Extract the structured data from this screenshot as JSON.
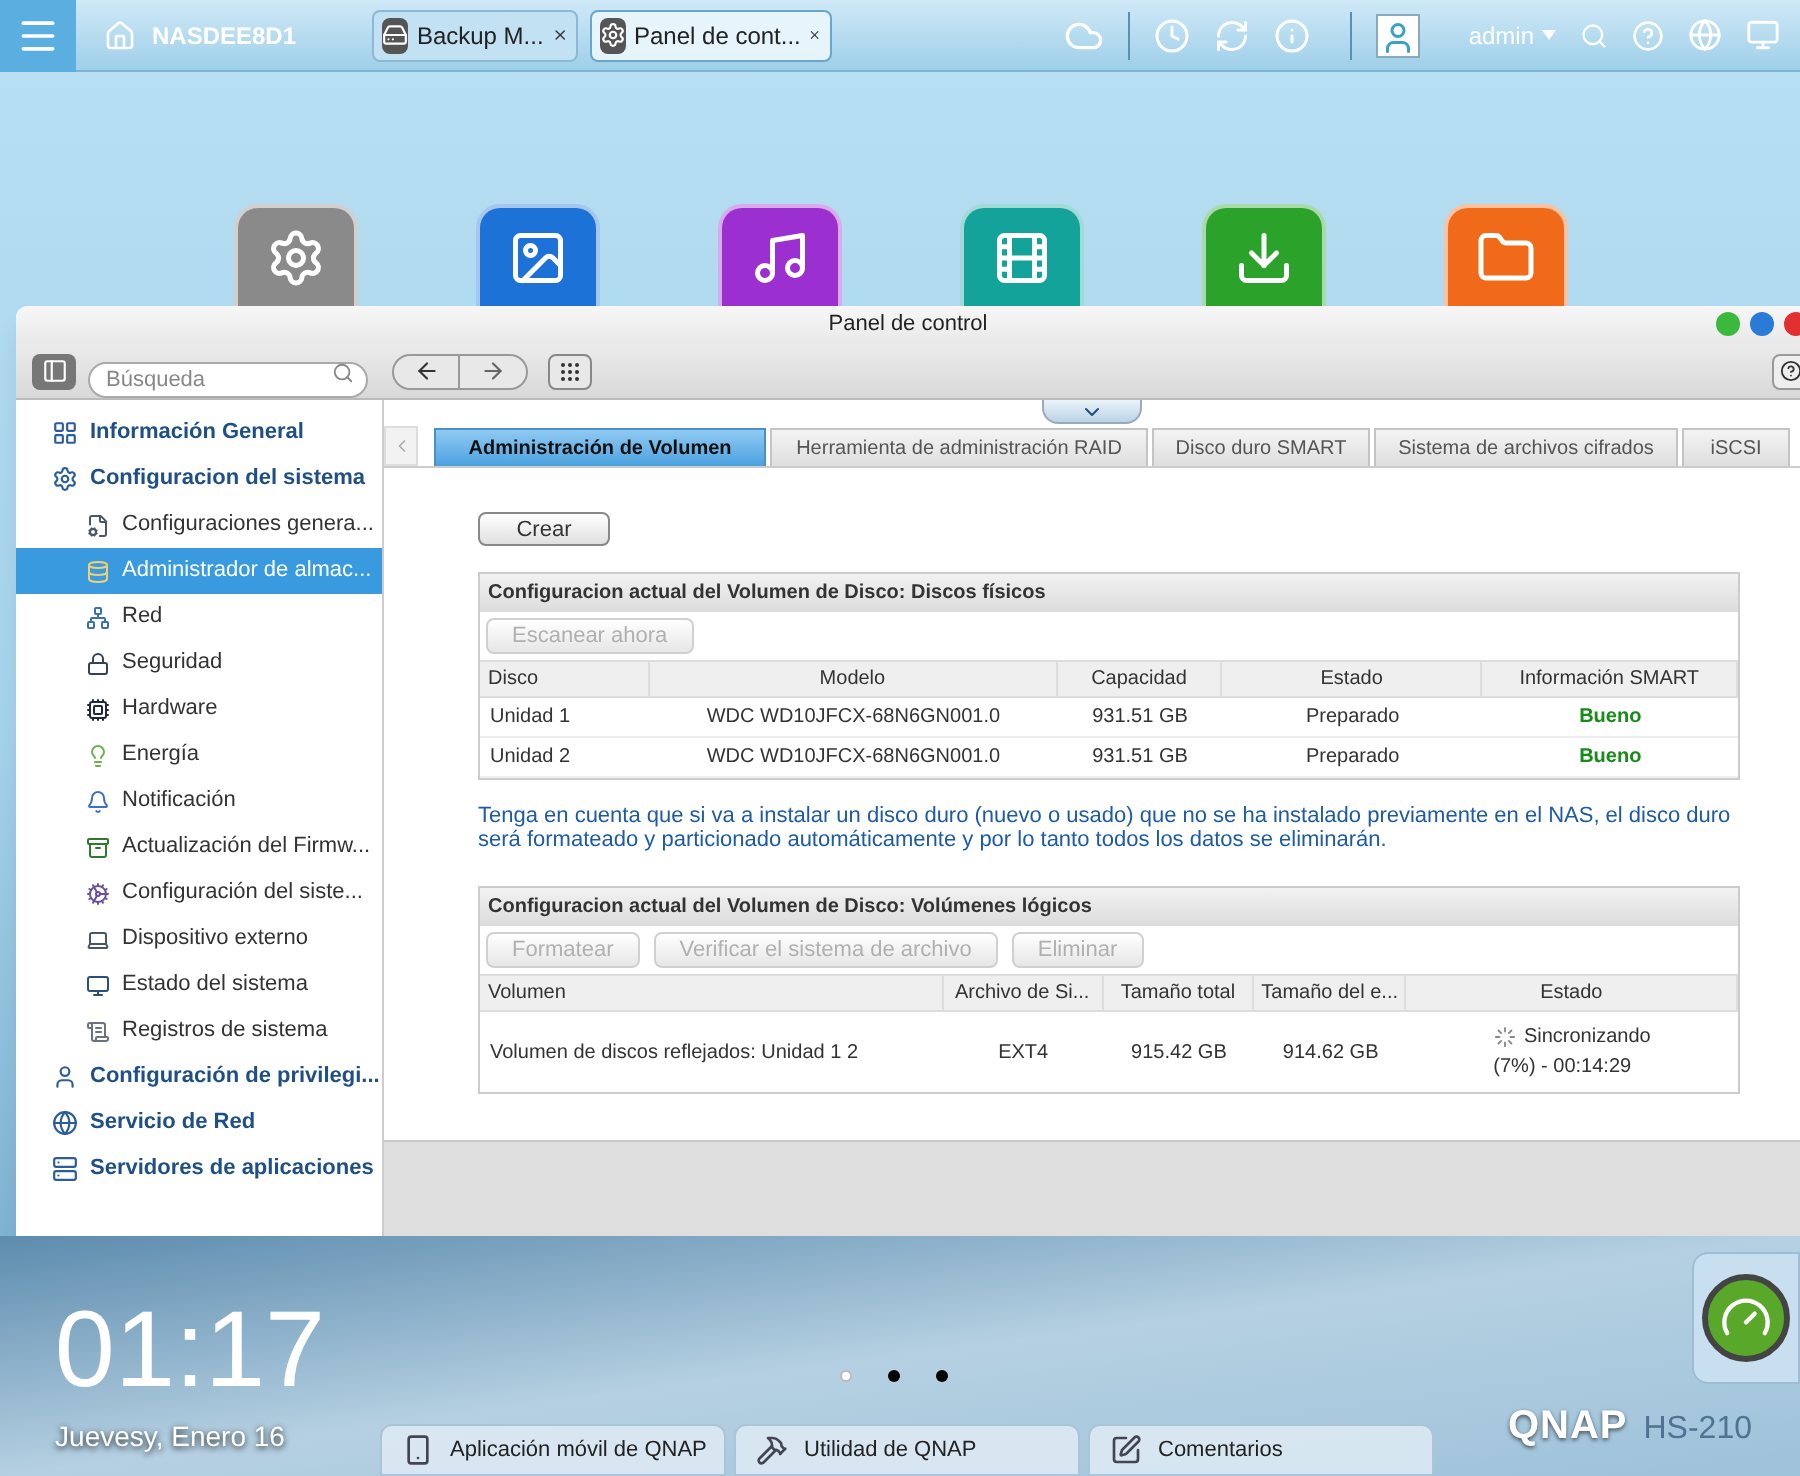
{
  "taskbar": {
    "host": "NASDEE8D1",
    "tabs": [
      {
        "label": "Backup M...",
        "selected": false
      },
      {
        "label": "Panel de cont...",
        "selected": true
      }
    ],
    "user": "admin"
  },
  "desktop_apps": [
    {
      "kind": "settings"
    },
    {
      "kind": "photo"
    },
    {
      "kind": "music"
    },
    {
      "kind": "video"
    },
    {
      "kind": "download"
    },
    {
      "kind": "folder"
    }
  ],
  "window": {
    "title": "Panel de control",
    "search": {
      "placeholder": "Búsqueda"
    }
  },
  "sidebar": {
    "items": [
      {
        "label": "Información General",
        "selected": false
      },
      {
        "label": "Configuracion del sistema",
        "selected": false,
        "children": [
          {
            "label": "Configuraciones genera...",
            "selected": false
          },
          {
            "label": "Administrador de almac...",
            "selected": true
          },
          {
            "label": "Red",
            "selected": false
          },
          {
            "label": "Seguridad",
            "selected": false
          },
          {
            "label": "Hardware",
            "selected": false
          },
          {
            "label": "Energía",
            "selected": false
          },
          {
            "label": "Notificación",
            "selected": false
          },
          {
            "label": "Actualización del Firmw...",
            "selected": false
          },
          {
            "label": "Configuración del siste...",
            "selected": false
          },
          {
            "label": "Dispositivo externo",
            "selected": false
          },
          {
            "label": "Estado del sistema",
            "selected": false
          },
          {
            "label": "Registros de sistema",
            "selected": false
          }
        ]
      },
      {
        "label": "Configuración de privilegi...",
        "selected": false
      },
      {
        "label": "Servicio de Red",
        "selected": false
      },
      {
        "label": "Servidores de aplicaciones",
        "selected": false
      }
    ]
  },
  "tabs": [
    {
      "label": "Administración de Volumen",
      "selected": true
    },
    {
      "label": "Herramienta de administración RAID",
      "selected": false
    },
    {
      "label": "Disco duro SMART",
      "selected": false
    },
    {
      "label": "Sistema de archivos cifrados",
      "selected": false
    },
    {
      "label": "iSCSI",
      "selected": false
    }
  ],
  "create_button": "Crear",
  "physical_disks": {
    "title": "Configuracion actual del Volumen de Disco: Discos físicos",
    "buttons": [
      {
        "label": "Escanear ahora",
        "disabled": true
      }
    ],
    "columns": [
      "Disco",
      "Modelo",
      "Capacidad",
      "Estado",
      "Información SMART"
    ],
    "rows": [
      {
        "cells": [
          "Unidad 1",
          "WDC WD10JFCX-68N6GN001.0",
          "931.51 GB",
          "Preparado"
        ],
        "smart": "Bueno"
      },
      {
        "cells": [
          "Unidad 2",
          "WDC WD10JFCX-68N6GN001.0",
          "931.51 GB",
          "Preparado"
        ],
        "smart": "Bueno"
      }
    ]
  },
  "note": "Tenga en cuenta que si va a instalar un disco duro (nuevo o usado) que no se ha instalado previamente en el NAS, el disco duro será formateado y particionado automáticamente y por lo tanto todos los datos se eliminarán.",
  "logical_volumes": {
    "title": "Configuracion actual del Volumen de Disco: Volúmenes lógicos",
    "buttons": [
      {
        "label": "Formatear",
        "disabled": true
      },
      {
        "label": "Verificar el sistema de archivo",
        "disabled": true
      },
      {
        "label": "Eliminar",
        "disabled": true
      }
    ],
    "columns": [
      "Volumen",
      "Archivo de Si...",
      "Tamaño total",
      "Tamaño del e...",
      "Estado"
    ],
    "rows": [
      {
        "cells": [
          "Volumen de discos reflejados: Unidad 1 2",
          "EXT4",
          "915.42 GB",
          "914.62 GB"
        ],
        "status": "Sincronizando",
        "progress": "(7%) - 00:14:29"
      }
    ]
  },
  "clock": {
    "time": "01:17",
    "date": "Juevesy, Enero 16"
  },
  "pager": [
    {
      "selected": true
    },
    {
      "selected": false
    },
    {
      "selected": false
    }
  ],
  "dock": [
    "Aplicación móvil de QNAP",
    "Utilidad de QNAP",
    "Comentarios"
  ],
  "brand": {
    "logo": "QNAP",
    "model": "HS-210"
  }
}
